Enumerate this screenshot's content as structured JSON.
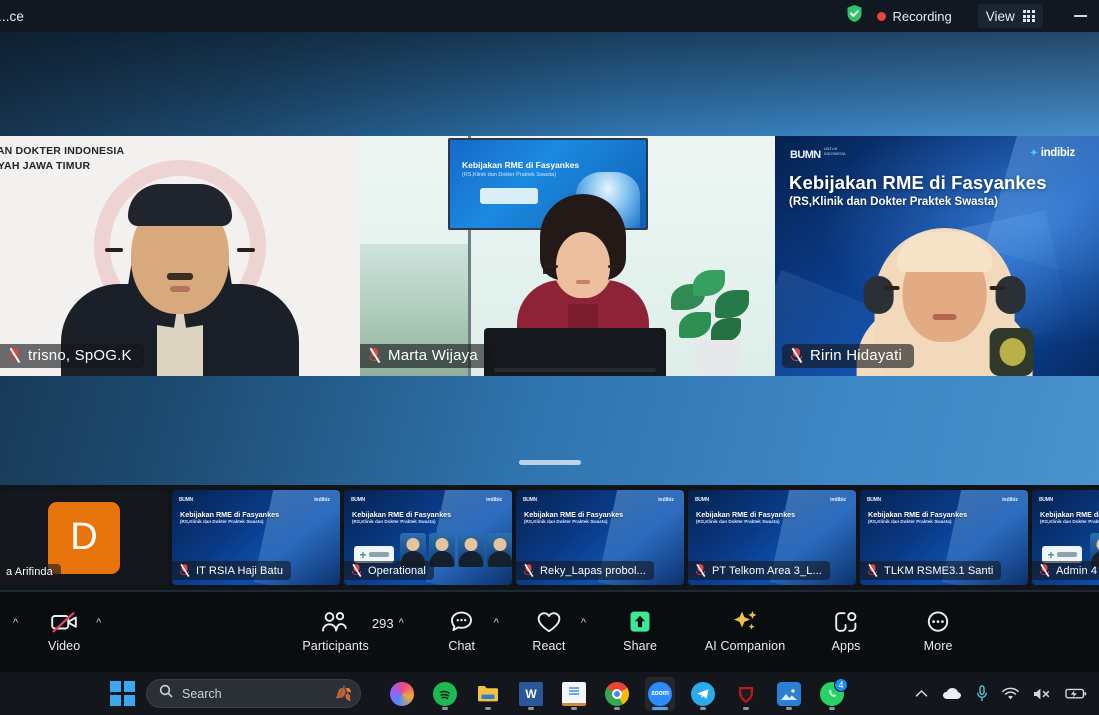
{
  "window": {
    "title": "...ce",
    "encryption_icon": "shield-check-icon",
    "recording_label": "Recording",
    "view_label": "View",
    "view_icon": "grid-icon",
    "minimize_icon": "minimize-icon"
  },
  "stage": {
    "drag_handle": "drag-handle",
    "tiles": [
      {
        "name": "trisno, SpOG.K",
        "muted": true,
        "speaking": false,
        "org_line1": "TAN DOKTER INDONESIA",
        "org_line2": "AYAH JAWA TIMUR",
        "backdrop": "idi-white-logo"
      },
      {
        "name": "Marta Wijaya",
        "muted": true,
        "speaking": true,
        "screen_title": "Kebijakan RME di Fasyankes",
        "screen_sub": "(RS,Klinik dan Dokter Praktek Swasta)",
        "backdrop": "office-room"
      },
      {
        "name": "Ririn Hidayati",
        "muted": true,
        "speaking": false,
        "deck_title": "Kebijakan RME di Fasyankes",
        "deck_sub": "(RS,Klinik dan Dokter Praktek Swasta)",
        "logo_left": "BUMN",
        "logo_left_sub": "UNTUK\nINDONESIA",
        "logo_right": "indibiz",
        "backdrop": "rme-blue-deck"
      }
    ]
  },
  "filmstrip": {
    "thumbs": [
      {
        "name": "a Arifinda",
        "type": "avatar",
        "avatar_letter": "D",
        "avatar_color": "#e8740c",
        "muted": false
      },
      {
        "name": "IT RSIA Haji Batu",
        "type": "deck",
        "muted": true,
        "variant": "plain"
      },
      {
        "name": "Operational",
        "type": "deck",
        "muted": true,
        "variant": "faces"
      },
      {
        "name": "Reky_Lapas  probol...",
        "type": "deck",
        "muted": true,
        "variant": "plain"
      },
      {
        "name": "PT Telkom Area 3_L...",
        "type": "deck",
        "muted": true,
        "variant": "plain"
      },
      {
        "name": "TLKM RSME3.1 Santi",
        "type": "deck",
        "muted": true,
        "variant": "plain"
      },
      {
        "name": "Admin 4",
        "type": "deck",
        "muted": true,
        "variant": "faces"
      }
    ],
    "deck_title": "Kebijakan RME di Fasyankes",
    "deck_sub": "(RS,Klinik dan Dokter Praktek Swasta)",
    "deck_logo_left": "BUMN",
    "deck_logo_right": "indibiz"
  },
  "controls": {
    "video": {
      "label": "Video",
      "icon": "video-off-icon",
      "state": "off",
      "has_caret": true,
      "left_caret": true
    },
    "participants": {
      "label": "Participants",
      "icon": "participants-icon",
      "count": "293",
      "has_caret": true
    },
    "chat": {
      "label": "Chat",
      "icon": "chat-icon",
      "has_caret": true
    },
    "react": {
      "label": "React",
      "icon": "heart-icon",
      "has_caret": true
    },
    "share": {
      "label": "Share",
      "icon": "share-screen-icon",
      "color": "#3ce896"
    },
    "ai_companion": {
      "label": "AI Companion",
      "icon": "sparkles-icon",
      "color": "#f0c24b"
    },
    "apps": {
      "label": "Apps",
      "icon": "apps-icon"
    },
    "more": {
      "label": "More",
      "icon": "more-dots-icon"
    }
  },
  "taskbar": {
    "start_icon": "windows-start-icon",
    "search": {
      "placeholder": "Search",
      "icon": "search-icon",
      "decoration_icon": "autumn-leaves-icon"
    },
    "apps": [
      {
        "name": "copilot",
        "label": "",
        "color": "#3b6ff5",
        "running": false
      },
      {
        "name": "spotify",
        "label": "",
        "color": "#1db954",
        "running": true
      },
      {
        "name": "file-explorer",
        "label": "",
        "color": "#f3c243",
        "running": true
      },
      {
        "name": "word",
        "label": "W",
        "color": "#2b579a",
        "running": true
      },
      {
        "name": "notepad",
        "label": "",
        "color": "#e8eef5",
        "running": true
      },
      {
        "name": "chrome",
        "label": "",
        "color": "#f4b400",
        "running": true
      },
      {
        "name": "zoom",
        "label": "zoom",
        "color": "#2d8cff",
        "running": true,
        "active": true
      },
      {
        "name": "telegram",
        "label": "",
        "color": "#2aabee",
        "running": true
      },
      {
        "name": "mcafee",
        "label": "",
        "color": "#c01818",
        "running": true
      },
      {
        "name": "photos",
        "label": "",
        "color": "#2b7fd4",
        "running": true
      },
      {
        "name": "whatsapp",
        "label": "",
        "color": "#25d366",
        "running": true,
        "badge": "4"
      }
    ],
    "tray": [
      {
        "name": "tray-overflow-icon"
      },
      {
        "name": "onedrive-cloud-icon"
      },
      {
        "name": "microphone-icon"
      },
      {
        "name": "wifi-icon"
      },
      {
        "name": "speaker-muted-icon"
      },
      {
        "name": "battery-charging-icon"
      }
    ]
  }
}
